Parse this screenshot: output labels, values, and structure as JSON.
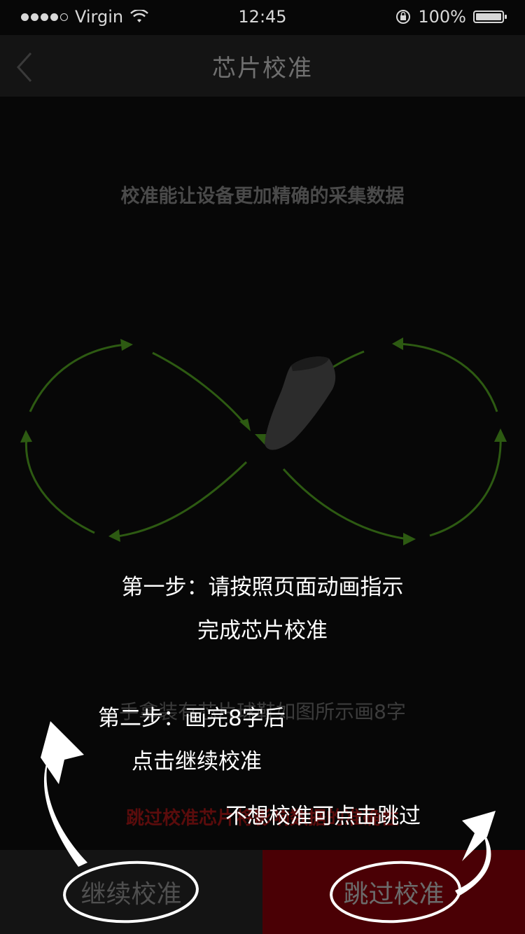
{
  "status_bar": {
    "carrier": "Virgin",
    "time": "12:45",
    "battery": "100%",
    "battery_level": 1.0,
    "signal_bars": 4
  },
  "nav": {
    "back_icon": "chevron-left-icon",
    "title": "芯片校准"
  },
  "subtitle": "校准能让设备更加精确的采集数据",
  "illustration": {
    "shoe_icon": "sock-shoe-icon",
    "path_color": "#2d5a12"
  },
  "annotations": {
    "step1_line1": "第一步：请按照页面动画指示",
    "step1_line2": "完成芯片校准",
    "step2_line1": "第二步：画完8字后",
    "step2_line2": "点击继续校准",
    "skip_note": "不想校准可点击跳过"
  },
  "hint_text": "手拿装有芯片球鞋如图所示画8字",
  "skip_text": "跳过校准芯片将影响数据的准确性",
  "buttons": {
    "continue_label": "继续校准",
    "skip_label": "跳过校准"
  },
  "colors": {
    "background": "#070707",
    "skip_button": "#4a0005",
    "arrow_green": "#2d5a12"
  }
}
